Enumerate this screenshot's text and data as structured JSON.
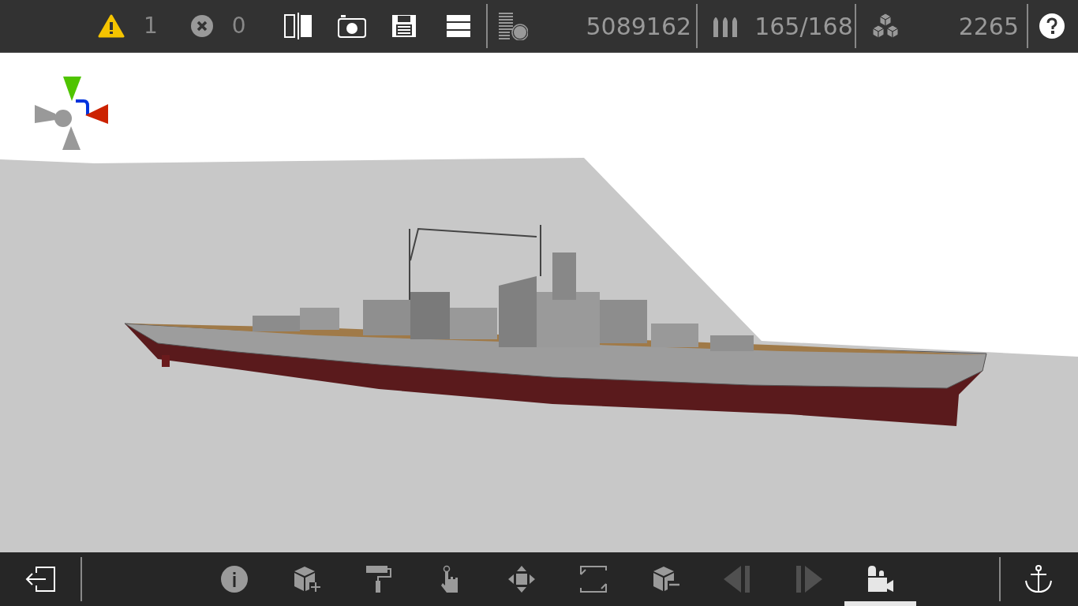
{
  "top_bar": {
    "warnings": "1",
    "errors": "0",
    "triangles": "5089162",
    "ammo": "165/168",
    "parts": "2265"
  },
  "toolbar": {
    "tools": [
      {
        "kind": "info",
        "selected": false,
        "disabled": false
      },
      {
        "kind": "add-block",
        "selected": false,
        "disabled": false
      },
      {
        "kind": "paint",
        "selected": false,
        "disabled": false
      },
      {
        "kind": "touch",
        "selected": false,
        "disabled": false
      },
      {
        "kind": "move",
        "selected": false,
        "disabled": false
      },
      {
        "kind": "frame",
        "selected": false,
        "disabled": false
      },
      {
        "kind": "remove-block",
        "selected": false,
        "disabled": false
      },
      {
        "kind": "prev",
        "selected": false,
        "disabled": true
      },
      {
        "kind": "next",
        "selected": false,
        "disabled": true
      },
      {
        "kind": "camera",
        "selected": true,
        "disabled": false
      }
    ]
  }
}
